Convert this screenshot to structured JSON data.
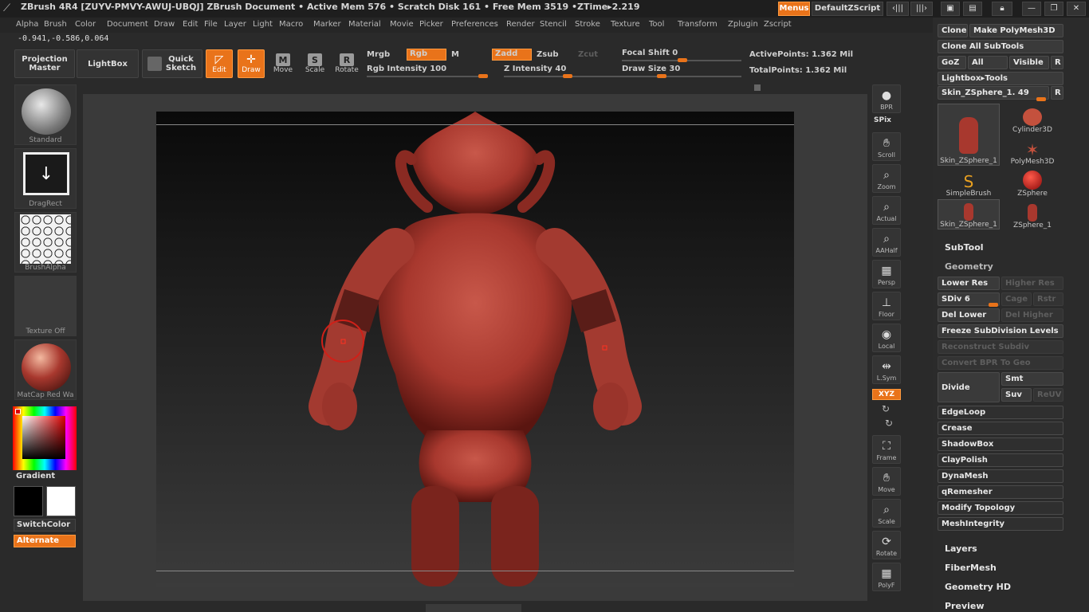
{
  "titlebar": {
    "title": "ZBrush 4R4 [ZUYV-PMVY-AWUJ-UBQJ]   ZBrush Document    • Active Mem 576 • Scratch Disk 161 • Free Mem 3519 •ZTime▸2.219",
    "menus_button": "Menus",
    "zscript_button": "DefaultZScript"
  },
  "menubar": {
    "items": [
      "Alpha",
      "Brush",
      "Color",
      "Document",
      "Draw",
      "Edit",
      "File",
      "Layer",
      "Light",
      "Macro",
      "Marker",
      "Material",
      "Movie",
      "Picker",
      "Preferences",
      "Render",
      "Stencil",
      "Stroke",
      "Texture",
      "Tool",
      "Transform",
      "Zplugin",
      "Zscript"
    ]
  },
  "coords": "-0.941,-0.586,0.064",
  "toolbar": {
    "projection_master": "Projection Master",
    "lightbox": "LightBox",
    "quick_sketch": "Quick Sketch",
    "edit": "Edit",
    "draw": "Draw",
    "move": "Move",
    "scale": "Scale",
    "rotate": "Rotate",
    "move_icon": "M",
    "scale_icon": "S",
    "rotate_icon": "R",
    "mrgb": "Mrgb",
    "rgb": "Rgb",
    "m": "M",
    "zadd": "Zadd",
    "zsub": "Zsub",
    "zcut": "Zcut",
    "rgb_intensity_label": "Rgb Intensity",
    "rgb_intensity_value": "100",
    "z_intensity_label": "Z Intensity",
    "z_intensity_value": "40",
    "focal_shift_label": "Focal Shift",
    "focal_shift_value": "0",
    "draw_size_label": "Draw Size",
    "draw_size_value": "30",
    "active_points": "ActivePoints: 1.362 Mil",
    "total_points": "TotalPoints: 1.362 Mil"
  },
  "left_shelf": {
    "brush_label": "Standard",
    "stroke_label": "DragRect",
    "alpha_label": "BrushAlpha",
    "texture_label": "Texture Off",
    "material_label": "MatCap Red Wa",
    "gradient_label": "Gradient",
    "switch_color": "SwitchColor",
    "alternate": "Alternate"
  },
  "right_shelf": {
    "bpr": "BPR",
    "spix": "SPix",
    "scroll": "Scroll",
    "zoom": "Zoom",
    "actual": "Actual",
    "aahalf": "AAHalf",
    "persp": "Persp",
    "floor": "Floor",
    "local": "Local",
    "lsym": "L.Sym",
    "xyz": "XYZ",
    "frame": "Frame",
    "move": "Move",
    "scale": "Scale",
    "rotate": "Rotate",
    "polyf": "PolyF"
  },
  "tool_panel": {
    "clone": "Clone",
    "make_polymesh": "Make PolyMesh3D",
    "clone_all": "Clone All SubTools",
    "goz": "GoZ",
    "all": "All",
    "visible": "Visible",
    "r": "R",
    "lightbox_tools": "Lightbox▸Tools",
    "current_tool": "Skin_ZSphere_1. 49",
    "tools": [
      {
        "label": "Skin_ZSphere_1"
      },
      {
        "label": "Cylinder3D"
      },
      {
        "label": "PolyMesh3D"
      },
      {
        "label": "SimpleBrush"
      },
      {
        "label": "ZSphere"
      },
      {
        "label": "Skin_ZSphere_1"
      },
      {
        "label": "ZSphere_1"
      }
    ],
    "subtool": "SubTool",
    "geometry": "Geometry",
    "lower_res": "Lower Res",
    "higher_res": "Higher Res",
    "sdiv": "SDiv 6",
    "cage": "Cage",
    "rstr": "Rstr",
    "del_lower": "Del Lower",
    "del_higher": "Del Higher",
    "freeze": "Freeze SubDivision Levels",
    "reconstruct": "Reconstruct Subdiv",
    "convert_bpr": "Convert BPR To Geo",
    "divide": "Divide",
    "smt": "Smt",
    "suv": "Suv",
    "reuv": "ReUV",
    "edgeloop": "EdgeLoop",
    "crease": "Crease",
    "shadowbox": "ShadowBox",
    "claypolish": "ClayPolish",
    "dynamesh": "DynaMesh",
    "qremesher": "qRemesher",
    "modify_topology": "Modify Topology",
    "meshintegrity": "MeshIntegrity",
    "layers": "Layers",
    "fibermesh": "FiberMesh",
    "geometry_hd": "Geometry HD",
    "preview": "Preview"
  },
  "colors": {
    "accent": "#e9731a",
    "model": "#a8382e"
  }
}
